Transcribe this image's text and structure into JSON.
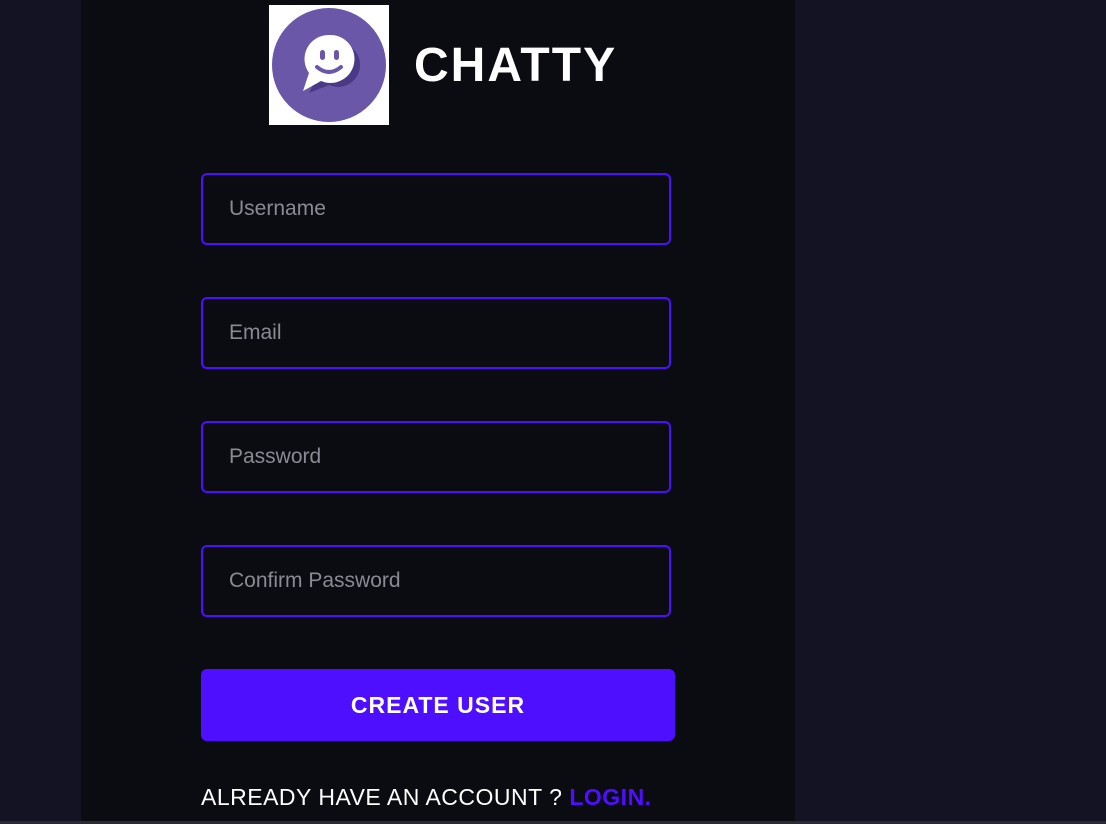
{
  "brand": {
    "title": "CHATTY",
    "logo_icon": "chat-bubble-smiley-icon"
  },
  "form": {
    "username_placeholder": "Username",
    "email_placeholder": "Email",
    "password_placeholder": "Password",
    "confirm_password_placeholder": "Confirm Password",
    "submit_label": "CREATE USER"
  },
  "footer": {
    "prompt": "ALREADY HAVE AN ACCOUNT ? ",
    "link_label": "LOGIN."
  },
  "colors": {
    "page_bg": "#131324",
    "panel_bg": "#0b0b12",
    "accent": "#4e0eff",
    "logo_purple": "#6b57a8"
  }
}
